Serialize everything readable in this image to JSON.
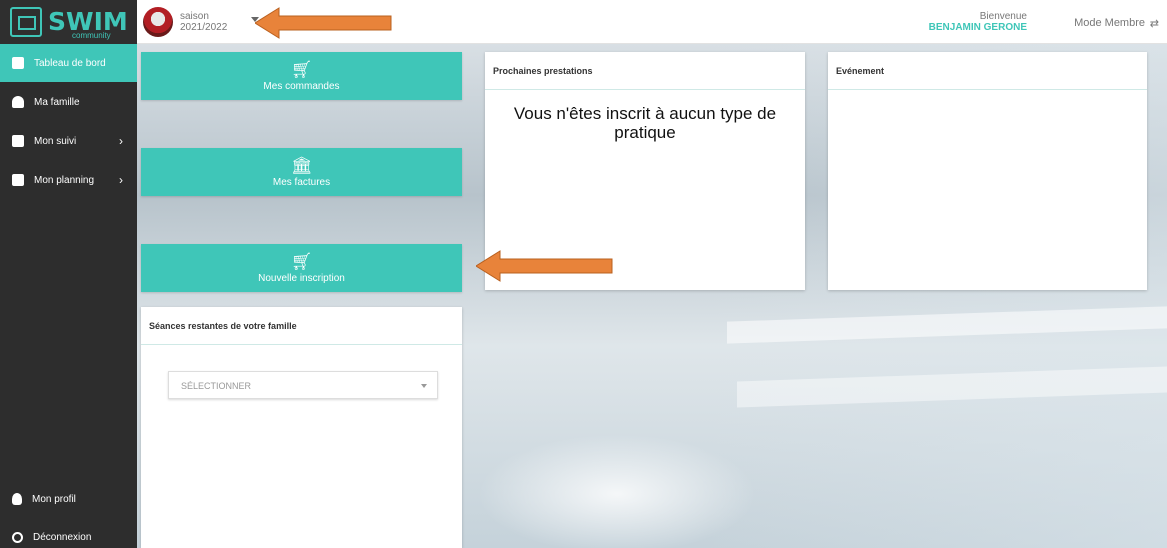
{
  "app": {
    "logo_text": "SWIM",
    "logo_sub": "community"
  },
  "topbar": {
    "season_label": "saison",
    "season_value": "2021/2022",
    "welcome_label": "Bienvenue",
    "user_name": "BENJAMIN GERONE",
    "mode_label": "Mode Membre"
  },
  "sidebar": {
    "items": [
      {
        "label": "Tableau de bord",
        "icon": "clipboard-icon",
        "active": true
      },
      {
        "label": "Ma famille",
        "icon": "users-icon"
      },
      {
        "label": "Mon suivi",
        "icon": "clipboard-icon",
        "has_submenu": true
      },
      {
        "label": "Mon planning",
        "icon": "calendar-icon",
        "has_submenu": true
      }
    ],
    "bottom_items": [
      {
        "label": "Mon profil",
        "icon": "user-icon"
      },
      {
        "label": "Déconnexion",
        "icon": "power-icon"
      }
    ]
  },
  "actions": {
    "orders": {
      "label": "Mes commandes",
      "icon": "cart-icon"
    },
    "invoices": {
      "label": "Mes factures",
      "icon": "bank-icon"
    },
    "new_registration": {
      "label": "Nouvelle inscription",
      "icon": "cart-plus-icon"
    }
  },
  "cards": {
    "next_services": {
      "title": "Prochaines prestations",
      "message": "Vous n'êtes inscrit à aucun type de pratique"
    },
    "events": {
      "title": "Evénement"
    },
    "remaining_sessions": {
      "title": "Séances restantes de votre famille",
      "select_placeholder": "SÉLECTIONNER"
    }
  },
  "colors": {
    "accent": "#3fc6b8",
    "sidebar_bg": "#2d2d2d",
    "annotation_arrow": "#e8833a"
  }
}
